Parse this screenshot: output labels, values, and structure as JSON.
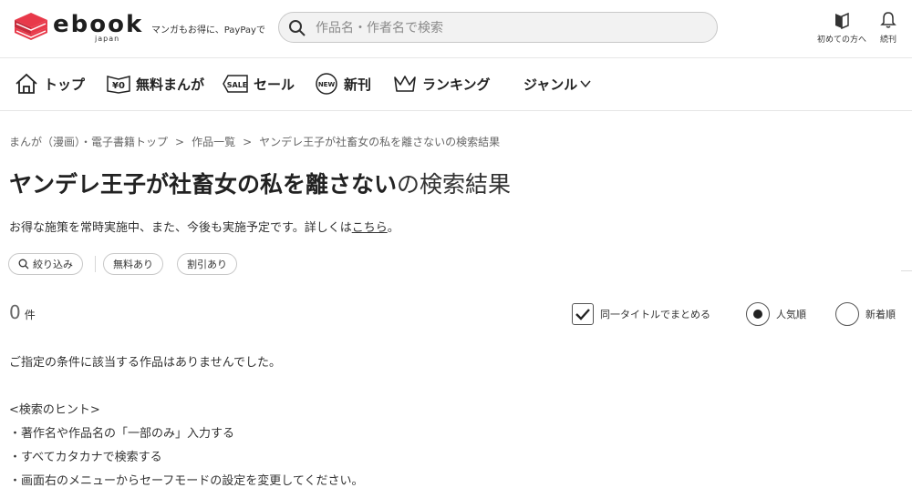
{
  "header": {
    "logo_text": "ebook",
    "logo_sub": "japan",
    "tagline": "マンガもお得に、PayPayで",
    "search_placeholder": "作品名・作者名で検索",
    "search_value": "",
    "first_time_label": "初めての方へ",
    "continue_label": "続刊",
    "brand_color": "#e8394a"
  },
  "nav": {
    "items": [
      {
        "label": "トップ",
        "icon": "home-icon"
      },
      {
        "label": "無料まんが",
        "icon": "yen-zero-icon"
      },
      {
        "label": "セール",
        "icon": "sale-tag-icon"
      },
      {
        "label": "新刊",
        "icon": "new-badge-icon"
      },
      {
        "label": "ランキング",
        "icon": "crown-icon"
      },
      {
        "label": "ジャンル",
        "icon": "chevron-down-icon"
      }
    ]
  },
  "breadcrumb": {
    "items": [
      "まんが（漫画）・電子書籍トップ",
      "作品一覧",
      "ヤンデレ王子が社畜女の私を離さないの検索結果"
    ],
    "separator": ">"
  },
  "page": {
    "title_keyword": "ヤンデレ王子が社畜女の私を離さない",
    "title_suffix": "の検索結果",
    "notice_text": "お得な施策を常時実施中、また、今後も実施予定です。詳しくは",
    "notice_link": "こちら",
    "notice_end": "。"
  },
  "filters": {
    "narrow_label": "絞り込み",
    "free_label": "無料あり",
    "discount_label": "割引あり"
  },
  "results": {
    "count": "0",
    "count_unit": "件",
    "group_title_label": "同一タイトルでまとめる",
    "group_title_checked": true,
    "sort_popular_label": "人気順",
    "sort_new_label": "新着順",
    "selected_sort": "人気順",
    "empty_message": "ご指定の条件に該当する作品はありませんでした。",
    "hint_heading": "<検索のヒント>",
    "hints": [
      "・著作名や作品名の「一部のみ」入力する",
      "・すべてカタカナで検索する",
      "・画面右のメニューからセーフモードの設定を変更してください。"
    ]
  }
}
